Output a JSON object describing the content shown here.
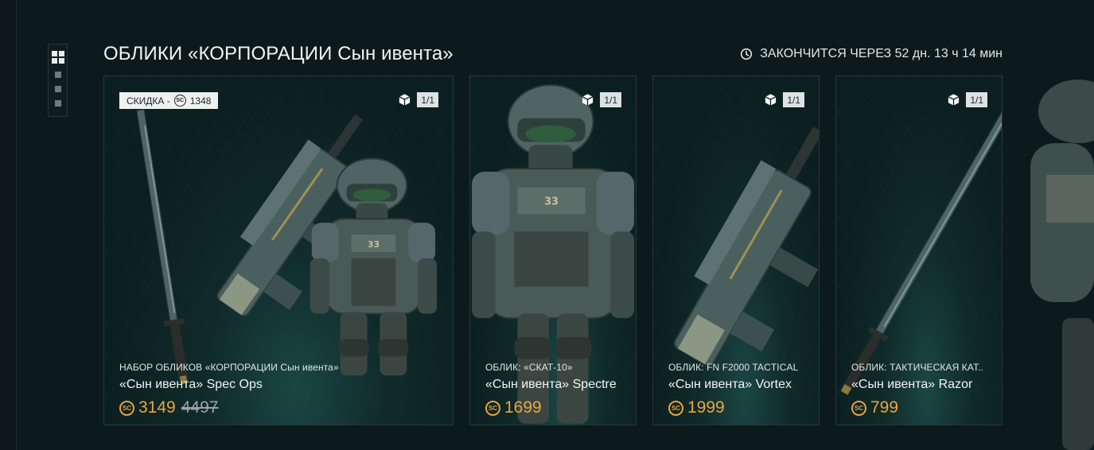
{
  "section": {
    "title": "ОБЛИКИ «КОРПОРАЦИИ Сын ивента»",
    "timer_text": "ЗАКОНЧИТСЯ ЧЕРЕЗ 52 дн. 13 ч 14 мин"
  },
  "icons": {
    "pager": "grid-icon",
    "timer": "clock-icon",
    "count": "cube-icon",
    "currency": "sc-coin-icon"
  },
  "currency_symbol": "SC",
  "colors": {
    "accent_price": "#eba63f",
    "background": "#0d1a1b",
    "card_glow": "#266662"
  },
  "cards": [
    {
      "discount_label": "СКИДКА -",
      "discount_value": "1348",
      "count": "1/1",
      "subtitle": "НАБОР ОБЛИКОВ «КОРПОРАЦИИ Сын ивента»",
      "name": "«Сын ивента» Spec Ops",
      "price": "3149",
      "old_price": "4497"
    },
    {
      "count": "1/1",
      "subtitle": "ОБЛИК: «СКАТ-10»",
      "name": "«Сын ивента» Spectre",
      "price": "1699"
    },
    {
      "count": "1/1",
      "subtitle": "ОБЛИК: FN F2000 TACTICAL",
      "name": "«Сын ивента» Vortex",
      "price": "1999"
    },
    {
      "count": "1/1",
      "subtitle": "ОБЛИК: ТАКТИЧЕСКАЯ КАТ..",
      "name": "«Сын ивента» Razor",
      "price": "799"
    }
  ]
}
